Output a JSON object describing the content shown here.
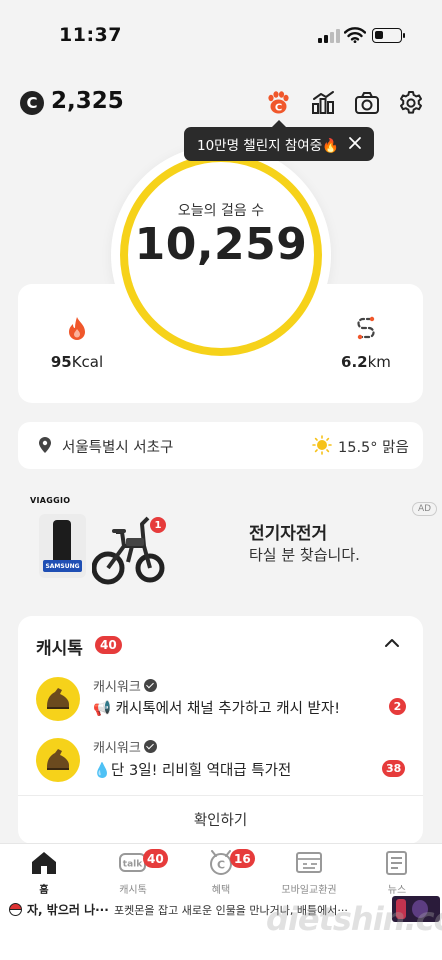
{
  "status_bar": {
    "time": "11:37",
    "battery_level": 0.35
  },
  "header": {
    "cash_symbol": "C",
    "cash_amount": "2,325",
    "icons": [
      "challenge-icon",
      "stats-icon",
      "camera-icon",
      "settings-icon"
    ]
  },
  "tooltip": {
    "text": "10만명 챌린지 참여중🔥"
  },
  "steps": {
    "label": "오늘의 걸음 수",
    "value": "10,259"
  },
  "stats": {
    "calories": {
      "value": "95",
      "unit": "Kcal"
    },
    "distance": {
      "value": "6.2",
      "unit": "km"
    }
  },
  "location": {
    "place": "서울특별시 서초구",
    "weather": "15.5° 맑음"
  },
  "ad": {
    "brand": "VIAGGIO",
    "phone_brand": "SAMSUNG",
    "notification_count": "1",
    "title": "전기자전거",
    "subtitle": "타실 분 찾습니다.",
    "badge": "AD"
  },
  "cashtalk": {
    "title": "캐시톡",
    "count": "40",
    "messages": [
      {
        "sender": "캐시워크",
        "text": "📢 캐시톡에서 채널 추가하고 캐시 받자!",
        "badge": "2"
      },
      {
        "sender": "캐시워크",
        "text": "💧단 3일! 리비힐 역대급 특가전",
        "badge": "38"
      }
    ],
    "confirm_label": "확인하기"
  },
  "bottom_nav": [
    {
      "label": "홈",
      "icon": "home-icon",
      "active": true
    },
    {
      "label": "캐시톡",
      "icon": "talk-icon",
      "badge": "40"
    },
    {
      "label": "혜택",
      "icon": "benefit-icon",
      "badge": "16"
    },
    {
      "label": "모바일교환권",
      "icon": "voucher-icon"
    },
    {
      "label": "뉴스",
      "icon": "news-icon"
    }
  ],
  "news_ticker": {
    "title": "자, 밖으러 나···",
    "text": "포켓몬을 잡고 새로운 인물을 만나거나, 배틀에서···"
  },
  "watermark": "dietshin.com",
  "colors": {
    "accent_yellow": "#f6d21a",
    "badge_red": "#e63b3b",
    "fire_orange": "#f0572b"
  }
}
